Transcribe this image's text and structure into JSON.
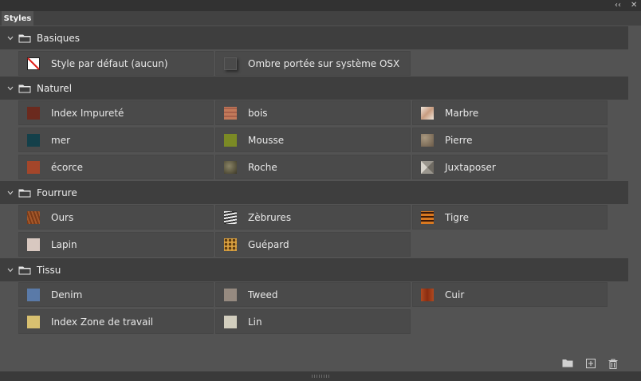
{
  "panel": {
    "tab_label": "Styles"
  },
  "groups": [
    {
      "label": "Basiques",
      "items": [
        {
          "label": "Style par défaut (aucun)",
          "swatch": "none"
        },
        {
          "label": "Ombre portée sur système OSX",
          "swatch": "shadow"
        }
      ]
    },
    {
      "label": "Naturel",
      "items": [
        {
          "label": "Index Impureté",
          "swatch": "#6b2a1e"
        },
        {
          "label": "bois",
          "swatch": "#c27a5a"
        },
        {
          "label": "Marbre",
          "swatch": "#e6d8cc"
        },
        {
          "label": "mer",
          "swatch": "#14404a"
        },
        {
          "label": "Mousse",
          "swatch": "#7b8a25"
        },
        {
          "label": "Pierre",
          "swatch": "#8a7a66"
        },
        {
          "label": "écorce",
          "swatch": "#a4462a"
        },
        {
          "label": "Roche",
          "swatch": "#5f5a40"
        },
        {
          "label": "Juxtaposer",
          "swatch": "#b0aca4"
        }
      ]
    },
    {
      "label": "Fourrure",
      "items": [
        {
          "label": "Ours",
          "swatch": "#7a3a18"
        },
        {
          "label": "Zèbrures",
          "swatch": "#e0e0e0"
        },
        {
          "label": "Tigre",
          "swatch": "#c86818"
        },
        {
          "label": "Lapin",
          "swatch": "#d8c8c0"
        },
        {
          "label": "Guépard",
          "swatch": "#d8a040"
        }
      ]
    },
    {
      "label": "Tissu",
      "items": [
        {
          "label": "Denim",
          "swatch": "#5a7aa8"
        },
        {
          "label": "Tweed",
          "swatch": "#968a80"
        },
        {
          "label": "Cuir",
          "swatch": "#9a3818"
        },
        {
          "label": "Index Zone de travail",
          "swatch": "#d8c070"
        },
        {
          "label": "Lin",
          "swatch": "#d2cebe"
        }
      ]
    }
  ]
}
